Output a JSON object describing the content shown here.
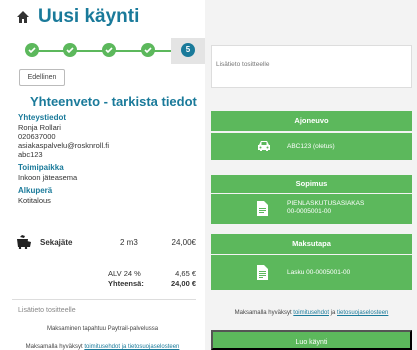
{
  "page": {
    "title": "Uusi käynti",
    "home_icon": "home-icon"
  },
  "steps": {
    "completed_count": 4,
    "current": "5",
    "colors": {
      "done": "#5cb85c",
      "active": "#1a7a9a"
    }
  },
  "back_button": "Edellinen",
  "summary": {
    "title": "Yhteenveto - tarkista tiedot",
    "contact": {
      "heading": "Yhteystiedot",
      "name": "Ronja Rollari",
      "phone": "020637000",
      "email": "asiakaspalvelu@rosknroll.fi",
      "code": "abc123"
    },
    "location": {
      "heading": "Toimipaikka",
      "value": "Inkoon jäteasema"
    },
    "origin": {
      "heading": "Alkuperä",
      "value": "Kotitalous"
    },
    "waste": {
      "icon": "trash-icon",
      "name": "Sekajäte",
      "quantity": "2 m3",
      "price": "24,00€"
    },
    "vat": {
      "label": "ALV 24 %",
      "value": "4,65 €"
    },
    "total": {
      "label": "Yhteensä:",
      "value": "24,00 €"
    },
    "notes_label": "Lisätieto tositteelle",
    "payment_note": "Maksaminen tapahtuu Paytrail-palvelussa",
    "accept_prefix": "Maksamalla hyväksyt ",
    "accept_link": "toimitusehdot ja tietosuojaselosteen"
  },
  "right": {
    "notes_placeholder": "Lisätieto tositteelle",
    "vehicle": {
      "heading": "Ajoneuvo",
      "icon": "car-icon",
      "value": "ABC123 (oletus)"
    },
    "contract": {
      "heading": "Sopimus",
      "icon": "document-icon",
      "line1": "PIENLASKUTUSASIAKAS",
      "line2": "00-0005001-00"
    },
    "payment": {
      "heading": "Maksutapa",
      "icon": "invoice-icon",
      "value": "Lasku 00-0005001-00"
    },
    "accept_prefix": "Maksamalla hyväksyt ",
    "accept_link1": "toimitusehdot",
    "accept_mid": " ja ",
    "accept_link2": "tietosuojaselosteen",
    "create_button": "Luo käynti"
  },
  "colors": {
    "accent": "#1a7a9a",
    "success": "#5cb85c"
  }
}
